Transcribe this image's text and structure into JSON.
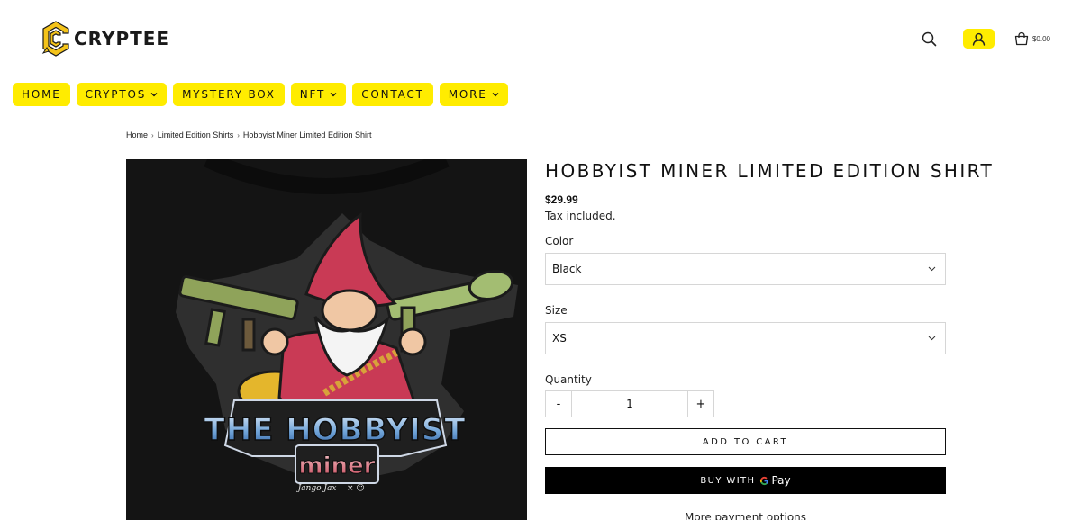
{
  "brand": {
    "name": "CRYPTEE"
  },
  "header": {
    "cart_total": "$0.00"
  },
  "nav": {
    "items": [
      {
        "label": "HOME",
        "dropdown": false
      },
      {
        "label": "CRYPTOS",
        "dropdown": true
      },
      {
        "label": "MYSTERY BOX",
        "dropdown": false
      },
      {
        "label": "NFT",
        "dropdown": true
      },
      {
        "label": "CONTACT",
        "dropdown": false
      },
      {
        "label": "MORE",
        "dropdown": true
      }
    ]
  },
  "breadcrumb": {
    "home": "Home",
    "category": "Limited Edition Shirts",
    "current": "Hobbyist Miner Limited Edition Shirt"
  },
  "product": {
    "title": "HOBBYIST MINER LIMITED EDITION SHIRT",
    "price": "$29.99",
    "tax_note": "Tax included.",
    "color_label": "Color",
    "color_value": "Black",
    "size_label": "Size",
    "size_value": "XS",
    "quantity_label": "Quantity",
    "quantity_value": "1",
    "minus": "-",
    "plus": "+",
    "add_to_cart": "ADD TO CART",
    "buy_with": "BUY WITH",
    "gpay_text": "Pay",
    "more_payment": "More payment options"
  },
  "artwork": {
    "line1": "THE HOBBYIST",
    "line2": "miner",
    "signature": "Jango Jax"
  },
  "colors": {
    "accent": "#ffec00",
    "dark": "#111111"
  },
  "icons": [
    "search-icon",
    "user-icon",
    "bag-icon",
    "chevron-down-icon",
    "cryptee-logo-icon",
    "google-g-icon"
  ]
}
